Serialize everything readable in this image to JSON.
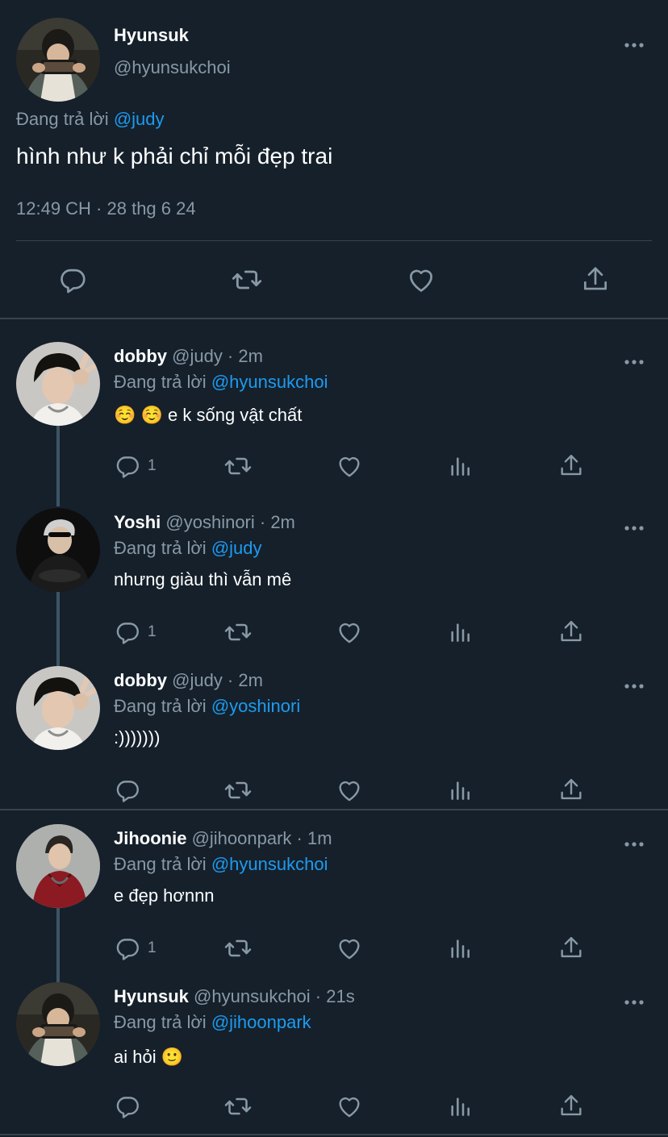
{
  "main_tweet": {
    "name": "Hyunsuk",
    "handle": "@hyunsukchoi",
    "reply_prefix": "Đang trả lời",
    "reply_to": "@judy",
    "text": "hình như k phải chỉ mỗi đẹp trai",
    "timestamp": "12:49 CH · 28 thg 6 24",
    "actions": [
      "reply-icon",
      "retweet-icon",
      "like-icon",
      "share-icon"
    ]
  },
  "replies": [
    {
      "name": "dobby",
      "meta": "@judy · 2m",
      "reply_prefix": "Đang trả lời",
      "reply_to": "@hyunsukchoi",
      "text": "☺️ ☺️  e k sống vật chất",
      "reply_count": "1"
    },
    {
      "name": "Yoshi",
      "meta": "@yoshinori · 2m",
      "reply_prefix": "Đang trả lời",
      "reply_to": "@judy",
      "text": "nhưng giàu thì vẫn mê",
      "reply_count": "1"
    },
    {
      "name": "dobby",
      "meta": "@judy · 2m",
      "reply_prefix": "Đang trả lời",
      "reply_to": "@yoshinori",
      "text": ":)))))))",
      "reply_count": ""
    },
    {
      "name": "Jihoonie",
      "meta": "@jihoonpark · 1m",
      "reply_prefix": "Đang trả lời",
      "reply_to": "@hyunsukchoi",
      "text": "e đẹp hơnnn",
      "reply_count": "1"
    },
    {
      "name": "Hyunsuk",
      "meta": "@hyunsukchoi · 21s",
      "reply_prefix": "Đang trả lời",
      "reply_to": "@jihoonpark",
      "text": "ai hỏi 🙂",
      "reply_count": ""
    }
  ],
  "colors": {
    "background": "#15202b",
    "secondary_text": "#8899a6",
    "mention": "#1d9bf0",
    "divider": "#38444d"
  }
}
